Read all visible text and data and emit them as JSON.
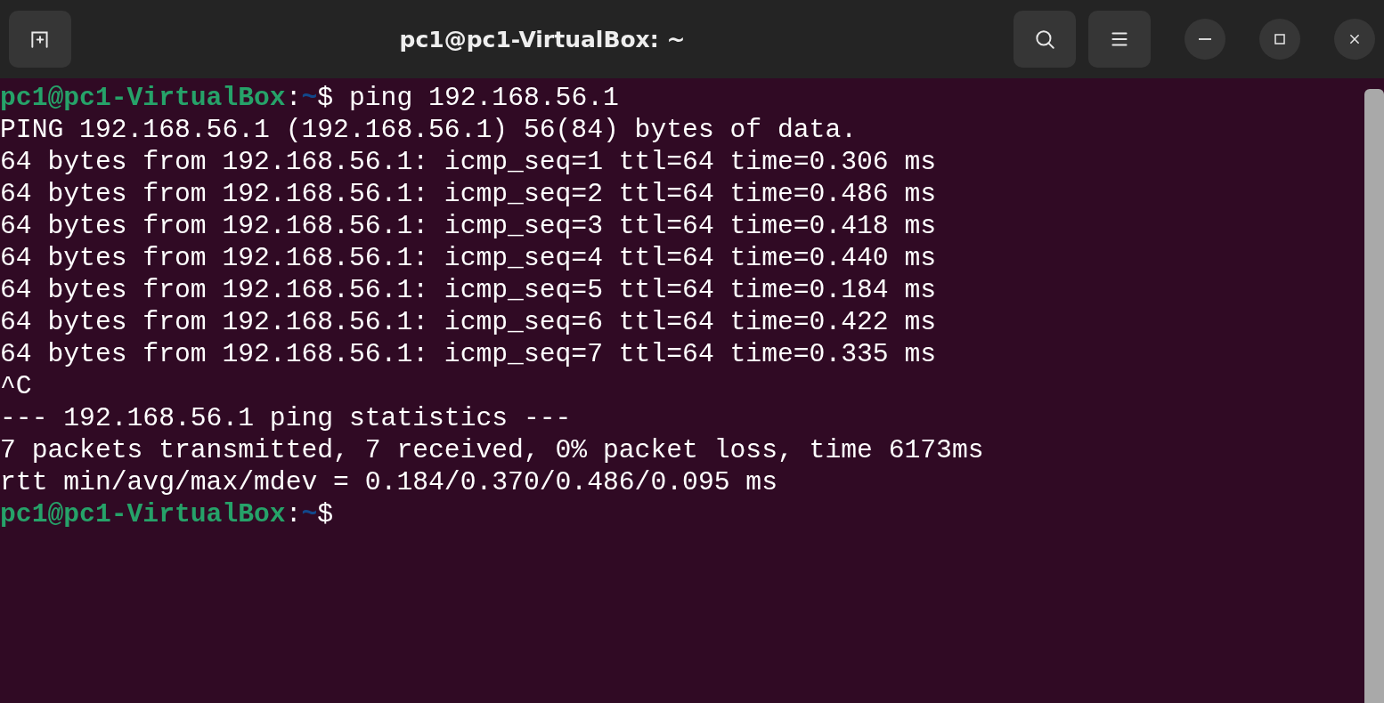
{
  "window": {
    "title": "pc1@pc1-VirtualBox: ~"
  },
  "terminal": {
    "lines": [
      {
        "kind": "prompt",
        "userhost": "pc1@pc1-VirtualBox",
        "colon": ":",
        "path": "~",
        "sign": "$",
        "command": " ping 192.168.56.1"
      },
      {
        "kind": "output",
        "text": "PING 192.168.56.1 (192.168.56.1) 56(84) bytes of data."
      },
      {
        "kind": "output",
        "text": "64 bytes from 192.168.56.1: icmp_seq=1 ttl=64 time=0.306 ms"
      },
      {
        "kind": "output",
        "text": "64 bytes from 192.168.56.1: icmp_seq=2 ttl=64 time=0.486 ms"
      },
      {
        "kind": "output",
        "text": "64 bytes from 192.168.56.1: icmp_seq=3 ttl=64 time=0.418 ms"
      },
      {
        "kind": "output",
        "text": "64 bytes from 192.168.56.1: icmp_seq=4 ttl=64 time=0.440 ms"
      },
      {
        "kind": "output",
        "text": "64 bytes from 192.168.56.1: icmp_seq=5 ttl=64 time=0.184 ms"
      },
      {
        "kind": "output",
        "text": "64 bytes from 192.168.56.1: icmp_seq=6 ttl=64 time=0.422 ms"
      },
      {
        "kind": "output",
        "text": "64 bytes from 192.168.56.1: icmp_seq=7 ttl=64 time=0.335 ms"
      },
      {
        "kind": "output",
        "text": "^C"
      },
      {
        "kind": "output",
        "text": "--- 192.168.56.1 ping statistics ---"
      },
      {
        "kind": "output",
        "text": "7 packets transmitted, 7 received, 0% packet loss, time 6173ms"
      },
      {
        "kind": "output",
        "text": "rtt min/avg/max/mdev = 0.184/0.370/0.486/0.095 ms"
      },
      {
        "kind": "prompt",
        "userhost": "pc1@pc1-VirtualBox",
        "colon": ":",
        "path": "~",
        "sign": "$"
      }
    ]
  }
}
